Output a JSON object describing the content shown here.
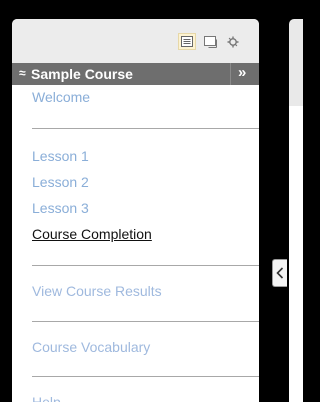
{
  "toolbar": {
    "buttons": [
      {
        "icon": "list-view-icon",
        "active": true
      },
      {
        "icon": "window-icon",
        "active": false
      },
      {
        "icon": "settings-icon",
        "active": false
      }
    ]
  },
  "course": {
    "collapse_glyph": "≈",
    "title": "Sample Course",
    "panel_toggle_glyph": "»"
  },
  "nav": {
    "welcome": "Welcome",
    "lessons": [
      "Lesson 1",
      "Lesson 2",
      "Lesson 3"
    ],
    "completion": "Course Completion",
    "results": "View Course Results",
    "vocabulary": "Course Vocabulary",
    "help": "Help"
  },
  "expand_tab": {
    "glyph": "<"
  }
}
